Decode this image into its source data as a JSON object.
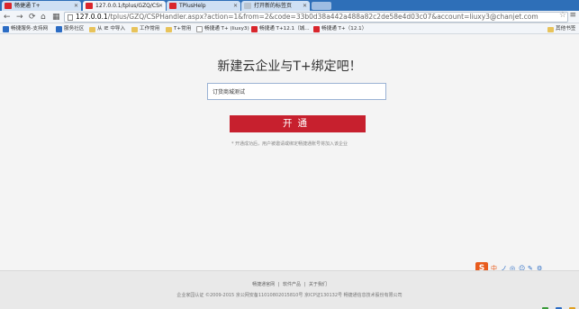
{
  "browser": {
    "tabs": [
      {
        "title": "畅捷通 T+",
        "active": false
      },
      {
        "title": "127.0.0.1/tplus/GZQ/CS",
        "active": true
      },
      {
        "title": "TPlusHelp",
        "active": false
      },
      {
        "title": "打开新的标签页",
        "active": false
      }
    ],
    "url": {
      "host": "127.0.0.1",
      "path": "/tplus/GZQ/CSPHandler.aspx?action=1&from=2&code=33b0d38a442a488a82c2de58e4d03c07&account=liuxy3@chanjet.com"
    },
    "bookmarks": [
      {
        "label": "畅捷服务-支持网",
        "icon": "blue"
      },
      {
        "label": "服务社区",
        "icon": "blue"
      },
      {
        "label": "从 IE 中导入",
        "icon": "folder"
      },
      {
        "label": "工作常用",
        "icon": "folder"
      },
      {
        "label": "T+常用",
        "icon": "folder"
      },
      {
        "label": "畅捷通 T+ (liuxy3)",
        "icon": "doc"
      },
      {
        "label": "畅捷通 T+12.1（城...",
        "icon": "red"
      },
      {
        "label": "畅捷通 T+（12.1）",
        "icon": "red"
      }
    ],
    "other_bookmarks": "其他书签"
  },
  "page": {
    "title": "新建云企业与T+绑定吧！",
    "company_name_value": "订货商城测试",
    "open_button_label": "开通",
    "hint": "* 开通成功后，用户被邀请或绑定畅捷通账号将加入该企业",
    "ime_toolbar": [
      "S",
      "中",
      "ノ",
      "◎",
      "☺",
      "✎",
      "⚙"
    ],
    "footer": {
      "links": [
        "畅捷通官网",
        "|",
        "软件产品",
        "|",
        "关于我们"
      ],
      "copyright": "企业家园认证 ©2009-2015 京公网安备11010802015810号 京ICP证130132号 畅捷通信息技术股份有限公司"
    }
  },
  "colors": {
    "brand_red": "#c7202e",
    "tab_strip": "#2e6fb8"
  }
}
